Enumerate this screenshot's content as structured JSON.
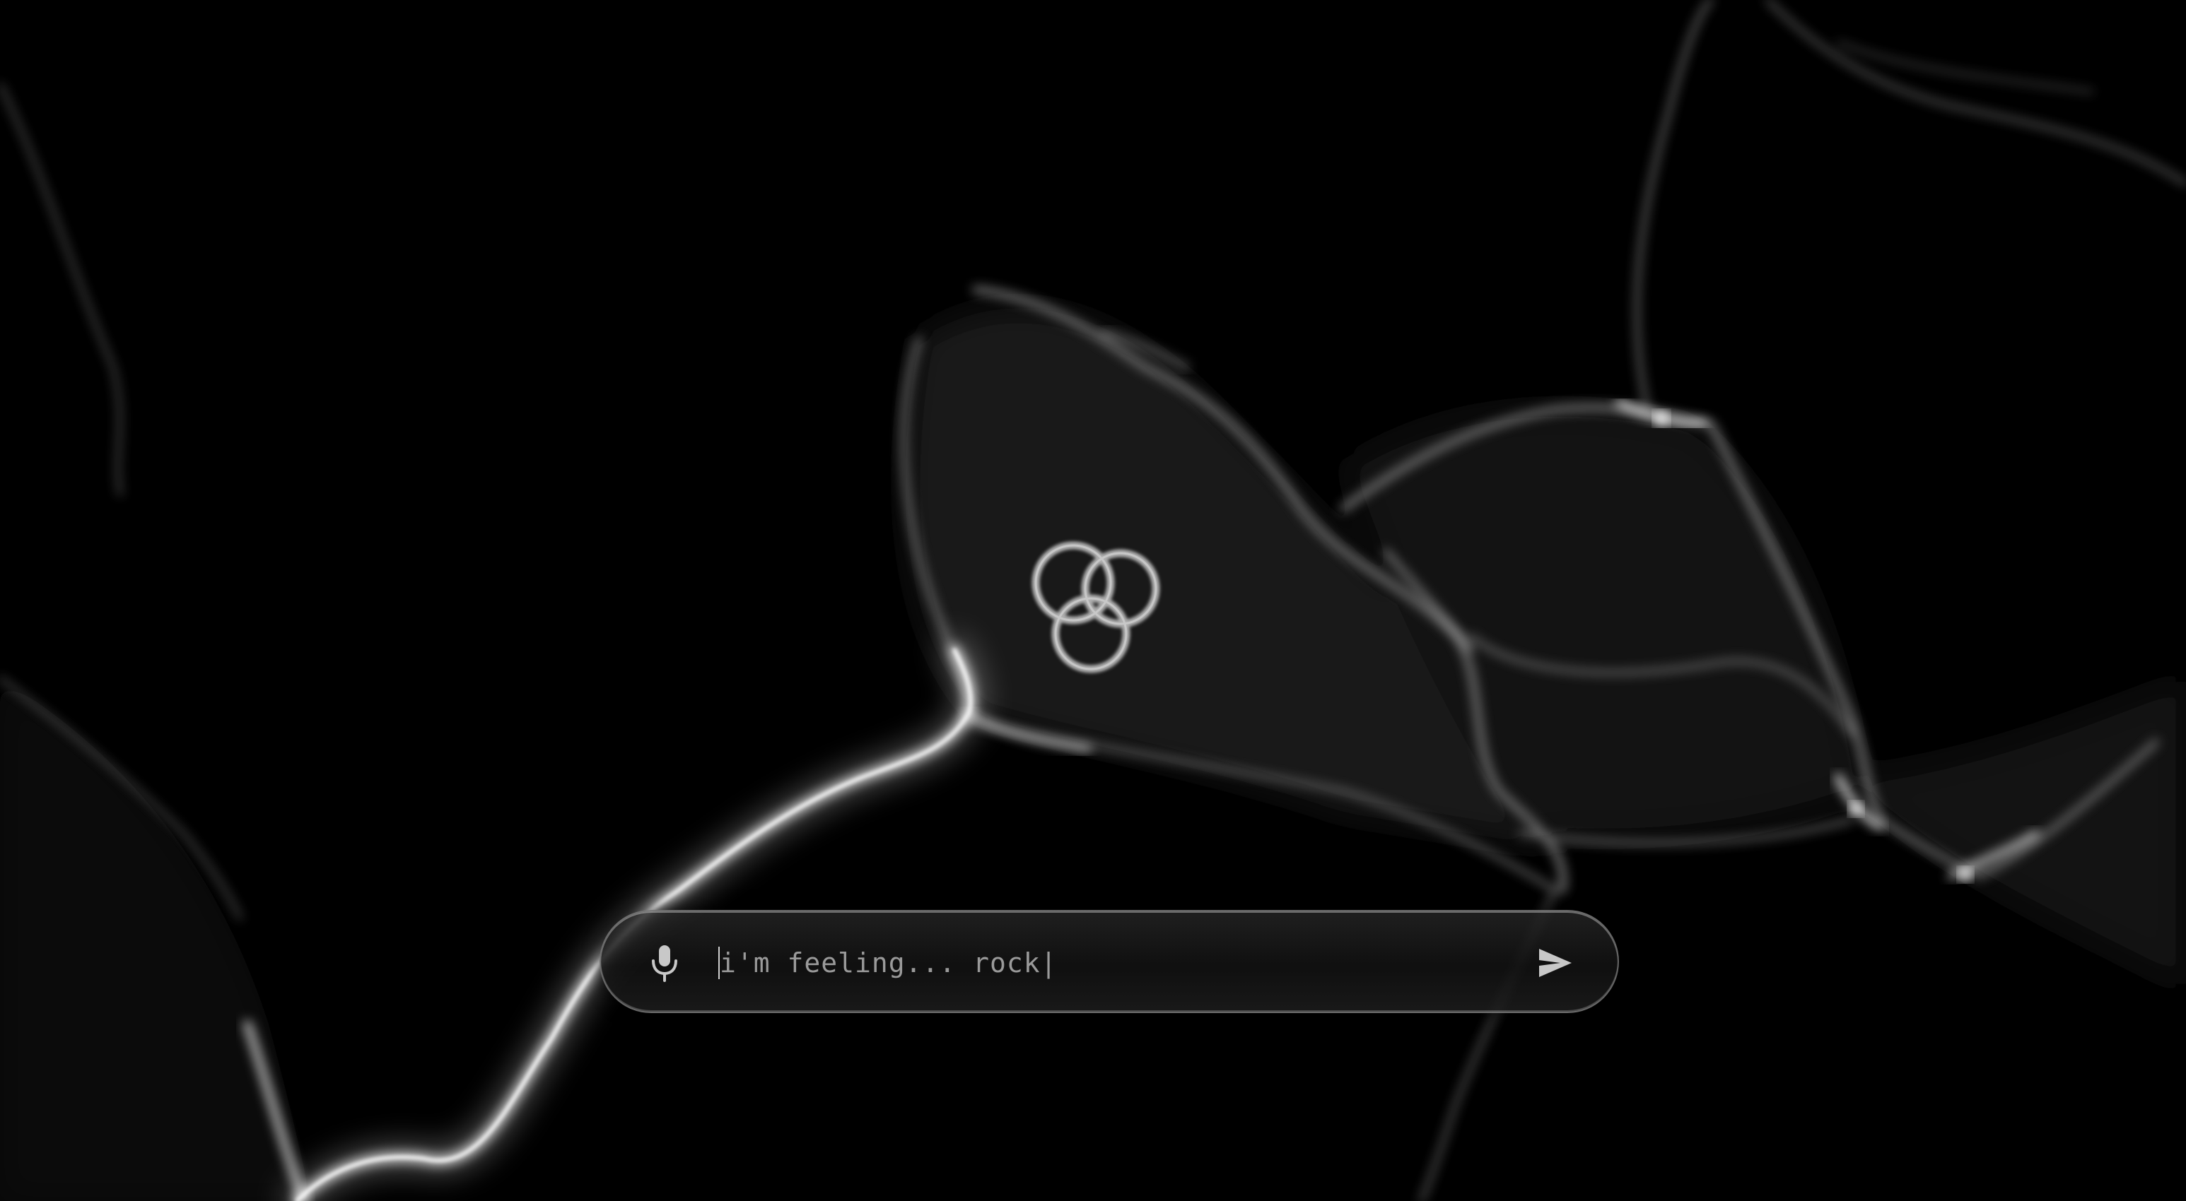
{
  "background": {
    "color": "#000000",
    "effect": "light-caustics",
    "glow_color": "#ffffff"
  },
  "logo": {
    "icon": "interlocking-rings-icon",
    "color": "#bdbdbd"
  },
  "prompt": {
    "value": "i'm feeling... rock|",
    "mic_icon": "microphone-icon",
    "send_icon": "send-arrow-icon",
    "text_color": "#9a9a9a"
  }
}
